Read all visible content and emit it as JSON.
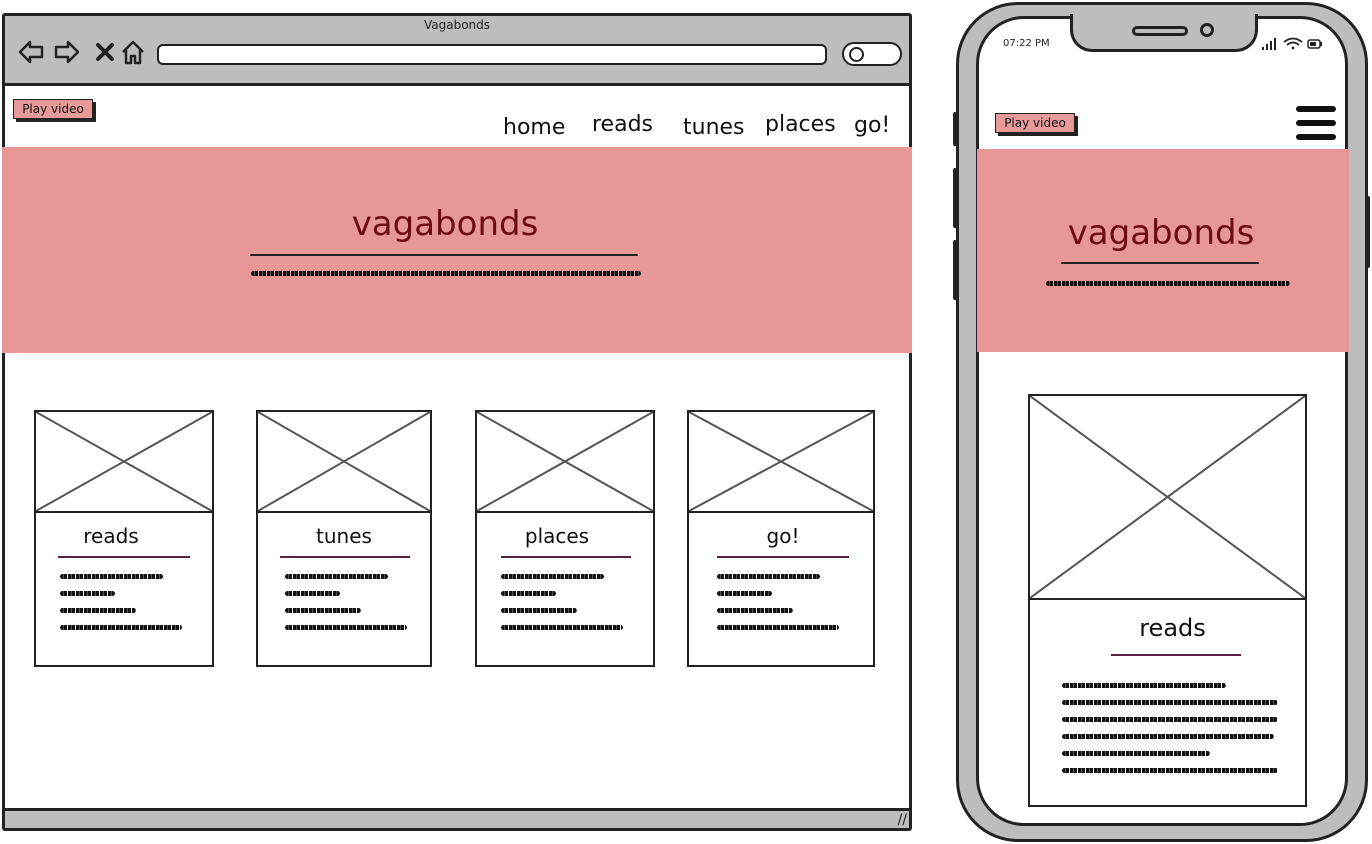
{
  "desktop": {
    "window_title": "Vagabonds",
    "play_video_label": "Play video",
    "nav": [
      "home",
      "reads",
      "tunes",
      "places",
      "go!"
    ],
    "hero_title": "vagabonds",
    "cards": [
      {
        "title": "reads"
      },
      {
        "title": "tunes"
      },
      {
        "title": "places"
      },
      {
        "title": "go!"
      }
    ]
  },
  "mobile": {
    "time": "07:22 PM",
    "play_video_label": "Play video",
    "hero_title": "vagabonds",
    "card": {
      "title": "reads"
    }
  },
  "colors": {
    "hero_bg": "#e89797",
    "hero_title": "#6b0d13",
    "button_bg": "#e89a9a",
    "chrome": "#bdbdbd"
  },
  "icons": [
    "back-arrow-icon",
    "forward-arrow-icon",
    "close-icon",
    "home-icon",
    "search-icon",
    "hamburger-menu-icon",
    "signal-icon",
    "wifi-icon",
    "battery-icon",
    "image-placeholder-icon",
    "resize-grip-icon"
  ]
}
